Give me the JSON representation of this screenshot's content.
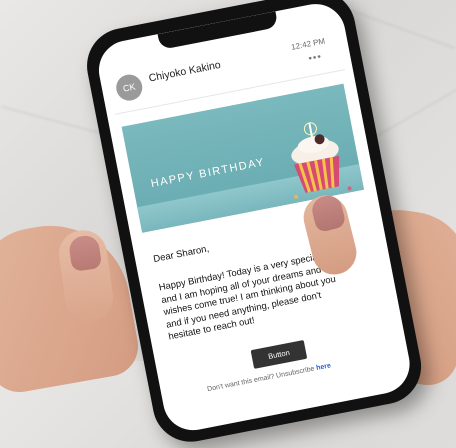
{
  "email": {
    "avatar_initials": "CK",
    "sender": "Chiyoko Kakino",
    "time": "12:42 PM",
    "more_label": "•••",
    "banner_title": "HAPPY BIRTHDAY",
    "greeting": "Dear Sharon,",
    "body": "Happy Birthday! Today is a very special day and I am hoping all of your dreams and wishes come true! I am thinking about you and if you need anything, please don't hesitate to reach out!",
    "button_label": "Button",
    "footer_text": "Don't want this email? Unsubscribe ",
    "footer_link": "here"
  },
  "colors": {
    "banner": "#6fb0b6",
    "button": "#333333",
    "link": "#2a63c9"
  }
}
